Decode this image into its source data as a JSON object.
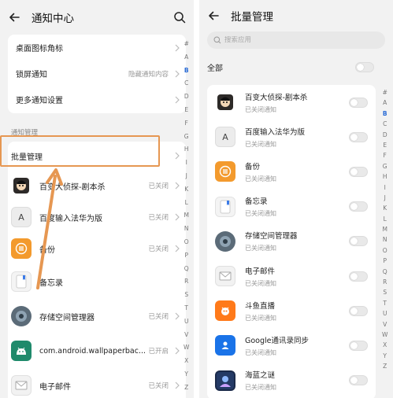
{
  "left": {
    "title": "通知中心",
    "settings": [
      {
        "label": "桌面图标角标",
        "hint": ""
      },
      {
        "label": "锁屏通知",
        "hint": "隐藏通知内容"
      },
      {
        "label": "更多通知设置",
        "hint": ""
      }
    ],
    "section_label": "通知管理",
    "batch_label": "批量管理",
    "apps": [
      {
        "name": "百变大侦探-剧本杀",
        "status": "已关闭",
        "icon": "detective-game-icon"
      },
      {
        "name": "百度输入法华为版",
        "status": "已关闭",
        "icon": "baidu-input-icon"
      },
      {
        "name": "备份",
        "status": "已关闭",
        "icon": "backup-icon"
      },
      {
        "name": "备忘录",
        "status": "已关闭",
        "icon": "notepad-icon"
      },
      {
        "name": "存储空间管理器",
        "status": "已关闭",
        "icon": "storage-manager-icon"
      },
      {
        "name": "com.android.wallpaperbac...",
        "status": "已开启",
        "icon": "android-icon"
      },
      {
        "name": "电子邮件",
        "status": "已关闭",
        "icon": "email-icon"
      }
    ],
    "alpha": [
      "#",
      "A",
      "B",
      "C",
      "D",
      "E",
      "F",
      "G",
      "H",
      "I",
      "J",
      "K",
      "L",
      "M",
      "N",
      "O",
      "P",
      "Q",
      "R",
      "S",
      "T",
      "U",
      "V",
      "W",
      "X",
      "Y",
      "Z"
    ],
    "alpha_active": "B"
  },
  "right": {
    "title": "批量管理",
    "search_placeholder": "搜索应用",
    "all_label": "全部",
    "apps": [
      {
        "name": "百变大侦探-剧本杀",
        "status": "已关闭通知",
        "icon": "detective-game-icon",
        "enabled": false
      },
      {
        "name": "百度输入法华为版",
        "status": "已关闭通知",
        "icon": "baidu-input-icon",
        "enabled": false
      },
      {
        "name": "备份",
        "status": "已关闭通知",
        "icon": "backup-icon",
        "enabled": false
      },
      {
        "name": "备忘录",
        "status": "已关闭通知",
        "icon": "notepad-icon",
        "enabled": false
      },
      {
        "name": "存储空间管理器",
        "status": "已关闭通知",
        "icon": "storage-manager-icon",
        "enabled": false
      },
      {
        "name": "电子邮件",
        "status": "已关闭通知",
        "icon": "email-icon",
        "enabled": false
      },
      {
        "name": "斗鱼直播",
        "status": "已关闭通知",
        "icon": "douyu-icon",
        "enabled": false
      },
      {
        "name": "Google通讯录同步",
        "status": "已关闭通知",
        "icon": "google-contacts-icon",
        "enabled": false
      },
      {
        "name": "海蓝之谜",
        "status": "已关闭通知",
        "icon": "game-icon",
        "enabled": false
      }
    ],
    "alpha": [
      "#",
      "A",
      "B",
      "C",
      "D",
      "E",
      "F",
      "G",
      "H",
      "I",
      "J",
      "K",
      "L",
      "M",
      "N",
      "O",
      "P",
      "Q",
      "R",
      "S",
      "T",
      "U",
      "V",
      "W",
      "X",
      "Y",
      "Z"
    ],
    "alpha_active": "B"
  },
  "colors": {
    "highlight": "#e69752",
    "accent": "#2a6cd6"
  }
}
